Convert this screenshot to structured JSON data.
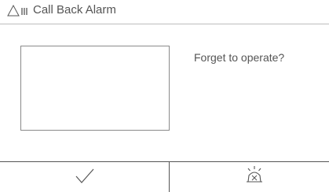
{
  "header": {
    "title": "Call Back Alarm",
    "icon": "warning-signal-icon"
  },
  "main": {
    "message": "Forget to operate?"
  },
  "footer": {
    "confirm_icon": "checkmark-icon",
    "alarm_icon": "alarm-bell-icon"
  }
}
